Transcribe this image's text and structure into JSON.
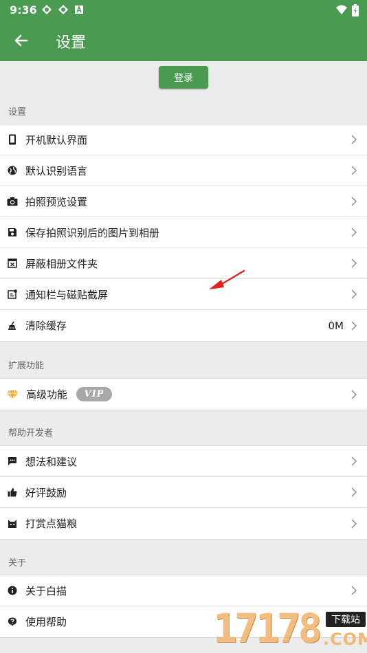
{
  "status": {
    "time": "9:36"
  },
  "appbar": {
    "title": "设置"
  },
  "login_label": "登录",
  "sections": {
    "settings": "设置",
    "extensions": "扩展功能",
    "help_dev": "帮助开发者",
    "about": "关于"
  },
  "settings_items": [
    {
      "label": "开机默认界面",
      "icon": "phone-icon"
    },
    {
      "label": "默认识别语言",
      "icon": "globe-icon"
    },
    {
      "label": "拍照预览设置",
      "icon": "camera-icon"
    },
    {
      "label": "保存拍照识别后的图片到相册",
      "icon": "save-icon"
    },
    {
      "label": "屏蔽相册文件夹",
      "icon": "folder-block-icon"
    },
    {
      "label": "通知栏与磁贴截屏",
      "icon": "notification-icon"
    },
    {
      "label": "清除缓存",
      "icon": "broom-icon",
      "value": "0M"
    }
  ],
  "extension_items": [
    {
      "label": "高级功能",
      "icon": "diamond-icon",
      "badge": "VIP"
    }
  ],
  "help_items": [
    {
      "label": "想法和建议",
      "icon": "chat-icon"
    },
    {
      "label": "好评鼓励",
      "icon": "thumbs-up-icon"
    },
    {
      "label": "打赏点猫粮",
      "icon": "cat-icon"
    }
  ],
  "about_items": [
    {
      "label": "关于白描",
      "icon": "info-icon"
    },
    {
      "label": "使用帮助",
      "icon": "help-icon"
    }
  ],
  "watermark": {
    "digits": "17178",
    "download": "下载站",
    "com": ".COM"
  },
  "colors": {
    "primary": "#4a9a52",
    "background": "#ececec",
    "vip_badge": "#a8a8a8",
    "diamond": "#f5a623",
    "annotation_arrow": "#e02020"
  }
}
